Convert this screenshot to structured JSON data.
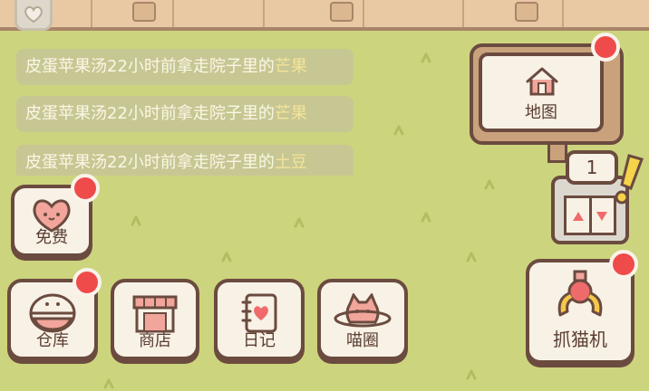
{
  "feed": [
    {
      "prefix": "皮蛋苹果汤22小时前拿走院子里的",
      "item": "芒果"
    },
    {
      "prefix": "皮蛋苹果汤22小时前拿走院子里的",
      "item": "芒果"
    },
    {
      "prefix": "皮蛋苹果汤22小时前拿走院子里的",
      "item": "土豆"
    }
  ],
  "buttons": {
    "free": "免费",
    "warehouse": "仓库",
    "shop": "商店",
    "diary": "日记",
    "meow_circle": "喵圈",
    "map": "地图",
    "claw_machine": "抓猫机"
  },
  "elevator": {
    "floor": "1"
  },
  "colors": {
    "grass": "#cdd47e",
    "card_bg": "#f8f1e6",
    "outline": "#6b4b3f",
    "notification_red": "#ef4b4b",
    "highlight_text": "#f4e49a",
    "icon_pink": "#f1a59b"
  },
  "icons": [
    "heart-icon",
    "map-house-icon",
    "elevator-icon",
    "exclamation-icon",
    "free-heart-icon",
    "warehouse-bowl-icon",
    "shop-stall-icon",
    "diary-book-icon",
    "cat-planet-icon",
    "claw-icon"
  ]
}
